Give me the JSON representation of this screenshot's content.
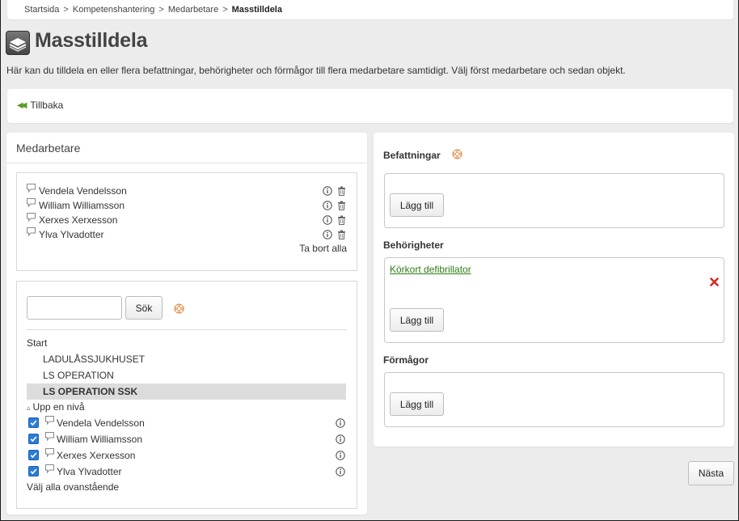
{
  "breadcrumb": {
    "items": [
      "Startsida",
      "Kompetenshantering",
      "Medarbetare"
    ],
    "separator": ">",
    "current": "Masstilldela"
  },
  "page": {
    "title": "Masstilldela",
    "intro": "Här kan du tilldela en eller flera befattningar, behörigheter och förmågor till flera medarbetare samtidigt. Välj först medarbetare och sedan objekt."
  },
  "back": {
    "label": "Tillbaka",
    "icon": "double-arrow-left-icon"
  },
  "employees": {
    "heading": "Medarbetare",
    "selected": [
      "Vendela Vendelsson",
      "William Williamsson",
      "Xerxes Xerxesson",
      "Ylva Ylvadotter"
    ],
    "remove_all": "Ta bort alla",
    "search": {
      "value": "",
      "placeholder": "",
      "button": "Sök"
    },
    "tree": {
      "root": "Start",
      "units": [
        "LADULÅSSJUKHUSET",
        "LS OPERATION"
      ],
      "current_unit": "LS OPERATION SSK",
      "up_level": "Upp en nivå",
      "members": [
        {
          "name": "Vendela Vendelsson",
          "checked": true
        },
        {
          "name": "William Williamsson",
          "checked": true
        },
        {
          "name": "Xerxes Xerxesson",
          "checked": true
        },
        {
          "name": "Ylva Ylvadotter",
          "checked": true
        }
      ],
      "select_all": "Välj alla ovanstående"
    }
  },
  "assign": {
    "positions": {
      "title": "Befattningar",
      "items": [],
      "add": "Lägg till"
    },
    "permissions": {
      "title": "Behörigheter",
      "items": [
        "Körkort defibrillator"
      ],
      "add": "Lägg till"
    },
    "abilities": {
      "title": "Förmågor",
      "items": [],
      "add": "Lägg till"
    }
  },
  "next": "Nästa",
  "colors": {
    "background": "#ececec",
    "link_green": "#2f7d14",
    "checkbox_blue": "#2b7bd9",
    "delete_red": "#d42a2a",
    "help_orange": "#e38a4a"
  }
}
